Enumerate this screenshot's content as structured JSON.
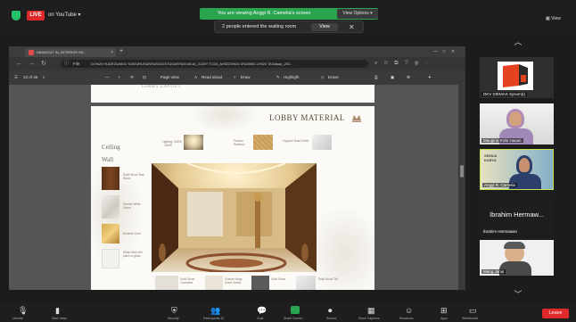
{
  "zoom": {
    "live_label": "LIVE",
    "youtube_label": "on YouTube ▾",
    "viewing_banner": "You are viewing Anggi R. Camelia's screen",
    "view_options": "View Options ▾",
    "waiting_room": "2 people entered the waiting room",
    "view_button": "View",
    "close_symbol": "✕",
    "view_mode": "▦ View"
  },
  "browser": {
    "tab_title": "HANDOUT IN_INTERIOR DE...",
    "tab_close": "×",
    "new_tab": "+",
    "url_scheme": "File",
    "url": "D:/%20 HUDEGUM/11 %20/URUSAN%20/DOSTUGAS%20 AK16_2120Y TC03_AH0223%20 4%20MG.LI%20 TAGasap_202...",
    "pdf_toolbar": {
      "page_indicator": "13 of 46",
      "zoom_minus": "—",
      "zoom_plus": "+",
      "page_view": "Page view",
      "read_aloud": "Read aloud",
      "draw": "Draw",
      "highlight": "Highlight",
      "erase": "Erase"
    }
  },
  "pdf_page": {
    "prev_page_title": "LOBBY LAYOUT",
    "title": "LOBBY MATERIAL",
    "ceiling_label": "Ceiling",
    "wall_label": "Wall",
    "materials": {
      "lighting": "Lighting: 3000K - 4000K",
      "persian_rainbow": "Persian Rainbow",
      "gypsum_board": "Gypsum Board Satin",
      "solid_wood_teak": "Solid Wood Teak Wood",
      "granite_white": "Granite White Grace",
      "brushed_gold": "Brushed Gold",
      "white_wall": "White Wall with paint on glass",
      "bottom_1": "Solid Stone Travertine",
      "bottom_2": "Granite Beige Sheet Series",
      "bottom_3": "Solid Stone",
      "bottom_4": "Solid Wood Tile"
    }
  },
  "participants": [
    {
      "name": "DKV DIEMAS Sysom(t)"
    },
    {
      "name": "Maugina Rizki Hasari"
    },
    {
      "name": "Anggi R. Camelia"
    },
    {
      "name": "Ibrahim Hermaw..."
    },
    {
      "name": "Ibrahim Hermawan"
    },
    {
      "name": "Mang Jarial"
    }
  ],
  "participant_card_3_text": "SEMUA KARYA",
  "footer": {
    "leave": "Leave",
    "items": [
      "Unmute",
      "Start Video",
      "Security",
      "Participants 43",
      "Chat",
      "Share Screen",
      "Record",
      "Show Captions",
      "Reactions",
      "Apps",
      "Whiteboard"
    ]
  },
  "colors": {
    "zoom_green": "#2aa44f",
    "leave_red": "#e0292b",
    "active_speaker": "#c4e04a"
  }
}
